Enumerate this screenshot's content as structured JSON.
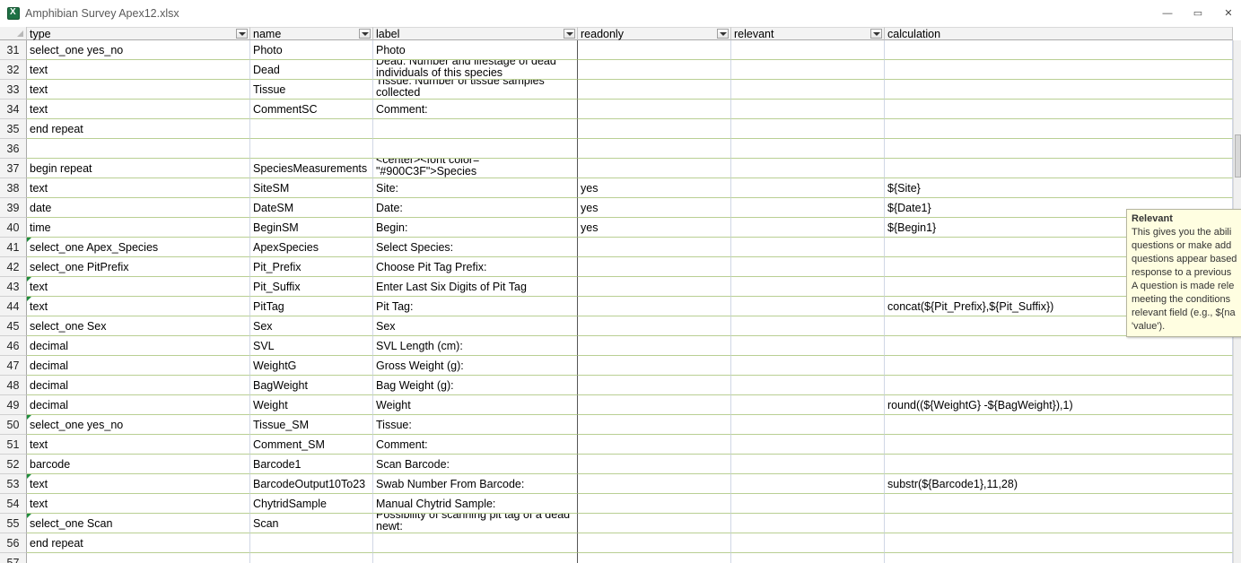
{
  "window": {
    "title": "Amphibian Survey Apex12.xlsx",
    "buttons": {
      "minimize": "—",
      "restore": "▭",
      "close": "✕"
    }
  },
  "columns": [
    "type",
    "name",
    "label",
    "readonly",
    "relevant",
    "calculation"
  ],
  "rows": [
    {
      "num": "31",
      "cells": [
        "select_one yes_no",
        "Photo",
        "Photo",
        "",
        "",
        ""
      ]
    },
    {
      "num": "32",
      "cells": [
        "text",
        "Dead",
        "Dead: Number and lifestage of dead individuals of this species",
        "",
        "",
        ""
      ]
    },
    {
      "num": "33",
      "cells": [
        "text",
        "Tissue",
        "Tissue: Number of tissue samples collected",
        "",
        "",
        ""
      ]
    },
    {
      "num": "34",
      "cells": [
        "text",
        "CommentSC",
        "Comment:",
        "",
        "",
        ""
      ]
    },
    {
      "num": "35",
      "cells": [
        "end repeat",
        "",
        "",
        "",
        "",
        ""
      ]
    },
    {
      "num": "36",
      "cells": [
        "",
        "",
        "",
        "",
        "",
        ""
      ]
    },
    {
      "num": "37",
      "cells": [
        "begin repeat",
        "SpeciesMeasurements",
        "<center><font color= \"#900C3F\">Species",
        "",
        "",
        ""
      ]
    },
    {
      "num": "38",
      "cells": [
        "text",
        "SiteSM",
        "Site:",
        "yes",
        "",
        "${Site}"
      ]
    },
    {
      "num": "39",
      "cells": [
        "date",
        "DateSM",
        "Date:",
        "yes",
        "",
        "${Date1}"
      ]
    },
    {
      "num": "40",
      "cells": [
        "time",
        "BeginSM",
        "Begin:",
        "yes",
        "",
        "${Begin1}"
      ]
    },
    {
      "num": "41",
      "cells": [
        "select_one Apex_Species",
        "ApexSpecies",
        "Select Species:",
        "",
        "",
        ""
      ]
    },
    {
      "num": "42",
      "cells": [
        "select_one PitPrefix",
        "Pit_Prefix",
        "Choose Pit Tag Prefix:",
        "",
        "",
        ""
      ]
    },
    {
      "num": "43",
      "cells": [
        "text",
        "Pit_Suffix",
        "Enter Last Six Digits of Pit Tag",
        "",
        "",
        ""
      ]
    },
    {
      "num": "44",
      "cells": [
        "text",
        "PitTag",
        "Pit Tag:",
        "",
        "",
        "concat(${Pit_Prefix},${Pit_Suffix})"
      ]
    },
    {
      "num": "45",
      "cells": [
        "select_one Sex",
        "Sex",
        "Sex",
        "",
        "",
        ""
      ]
    },
    {
      "num": "46",
      "cells": [
        "decimal",
        "SVL",
        "SVL Length (cm):",
        "",
        "",
        ""
      ]
    },
    {
      "num": "47",
      "cells": [
        "decimal",
        "WeightG",
        "Gross Weight (g):",
        "",
        "",
        ""
      ]
    },
    {
      "num": "48",
      "cells": [
        "decimal",
        "BagWeight",
        "Bag Weight (g):",
        "",
        "",
        ""
      ]
    },
    {
      "num": "49",
      "cells": [
        "decimal",
        "Weight",
        "Weight",
        "",
        "",
        "round((${WeightG} -${BagWeight}),1)"
      ]
    },
    {
      "num": "50",
      "cells": [
        "select_one yes_no",
        "Tissue_SM",
        "Tissue:",
        "",
        "",
        ""
      ]
    },
    {
      "num": "51",
      "cells": [
        "text",
        "Comment_SM",
        "Comment:",
        "",
        "",
        ""
      ]
    },
    {
      "num": "52",
      "cells": [
        "barcode",
        "Barcode1",
        "Scan Barcode:",
        "",
        "",
        ""
      ]
    },
    {
      "num": "53",
      "cells": [
        "text",
        "BarcodeOutput10To23",
        "Swab Number From Barcode:",
        "",
        "",
        "substr(${Barcode1},11,28)"
      ]
    },
    {
      "num": "54",
      "cells": [
        "text",
        "ChytridSample",
        "Manual Chytrid Sample:",
        "",
        "",
        ""
      ]
    },
    {
      "num": "55",
      "cells": [
        "select_one Scan",
        "Scan",
        "Possibility of scanning pit tag of a dead newt:",
        "",
        "",
        ""
      ]
    },
    {
      "num": "56",
      "cells": [
        "end repeat",
        "",
        "",
        "",
        "",
        ""
      ]
    },
    {
      "num": "57",
      "cells": [
        "",
        "",
        "",
        "",
        "",
        ""
      ]
    }
  ],
  "tooltip": {
    "title": "Relevant",
    "lines": [
      "This gives you the abili",
      "questions or make add",
      "questions appear based",
      "response to a previous",
      "A question is made rele",
      "meeting the conditions",
      "relevant field (e.g., ${na",
      "'value')."
    ]
  }
}
